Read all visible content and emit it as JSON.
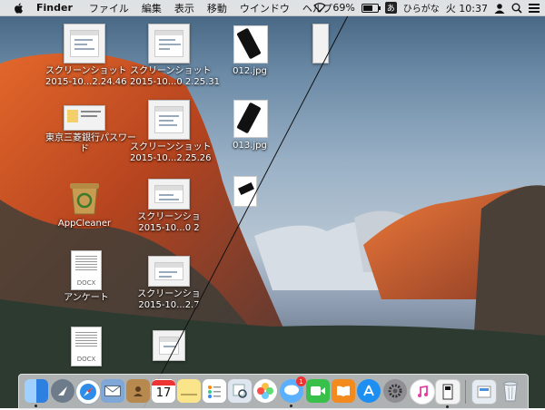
{
  "menubar": {
    "app_name": "Finder",
    "menus": [
      "ファイル",
      "編集",
      "表示",
      "移動",
      "ウインドウ",
      "ヘルプ"
    ],
    "battery_percent": "69%",
    "battery_level": 0.69,
    "ime_symbol": "あ",
    "input_mode": "ひらがな",
    "clock": "火 10:37"
  },
  "desktop": {
    "icons": [
      {
        "name": "スクリーンショット",
        "sub": "2015-10...2.24.46"
      },
      {
        "name": "スクリーンショット",
        "sub": "2015-10...0 2.25.31"
      },
      {
        "name": "012.jpg"
      },
      {
        "name": "東京三菱銀行パスワー",
        "sub": "ド"
      },
      {
        "name": "スクリーンショット",
        "sub": "2015-10...2.25.26"
      },
      {
        "name": "013.jpg"
      },
      {
        "name": "AppCleaner"
      },
      {
        "name": "スクリーンショ",
        "sub": "2015-10...0 2"
      },
      {
        "name": "アンケート"
      },
      {
        "name": "スクリーンショ",
        "sub": "2015-10...2.7"
      }
    ],
    "doc_tag": "DOCX"
  },
  "dock": {
    "calendar_day": "17",
    "messages_badge": "1",
    "items": [
      "finder-icon",
      "launchpad-icon",
      "safari-icon",
      "mail-icon",
      "contacts-icon",
      "calendar-icon",
      "notes-icon",
      "reminders-icon",
      "preview-icon",
      "photos-icon",
      "messages-icon",
      "facetime-icon",
      "ibooks-icon",
      "app-store-icon",
      "system-preferences-icon",
      "itunes-icon",
      "utility-icon",
      "downloads-folder-icon",
      "trash-icon"
    ]
  }
}
